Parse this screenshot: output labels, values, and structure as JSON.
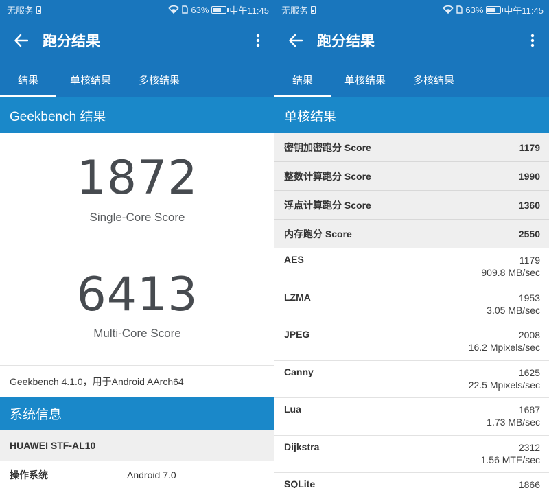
{
  "status_bar": {
    "carrier": "无服务",
    "battery_pct": "63%",
    "time": "中午11:45"
  },
  "app_bar": {
    "title": "跑分结果"
  },
  "tabs": [
    "结果",
    "单核结果",
    "多核结果"
  ],
  "active_tab": 0,
  "left": {
    "section_title": "Geekbench 结果",
    "single_core_score": "1872",
    "single_core_label": "Single-Core Score",
    "multi_core_score": "6413",
    "multi_core_label": "Multi-Core Score",
    "version_text": "Geekbench 4.1.0，用于Android AArch64",
    "system_info_title": "系统信息",
    "device_name": "HUAWEI STF-AL10",
    "info_rows": [
      {
        "key": "操作系统",
        "value": "Android 7.0"
      }
    ]
  },
  "right": {
    "section_title": "单核结果",
    "summary": [
      {
        "label": "密钥加密跑分 Score",
        "value": "1179"
      },
      {
        "label": "整数计算跑分 Score",
        "value": "1990"
      },
      {
        "label": "浮点计算跑分 Score",
        "value": "1360"
      },
      {
        "label": "内存跑分 Score",
        "value": "2550"
      }
    ],
    "benchmarks": [
      {
        "name": "AES",
        "score": "1179",
        "rate": "909.8 MB/sec"
      },
      {
        "name": "LZMA",
        "score": "1953",
        "rate": "3.05 MB/sec"
      },
      {
        "name": "JPEG",
        "score": "2008",
        "rate": "16.2 Mpixels/sec"
      },
      {
        "name": "Canny",
        "score": "1625",
        "rate": "22.5 Mpixels/sec"
      },
      {
        "name": "Lua",
        "score": "1687",
        "rate": "1.73 MB/sec"
      },
      {
        "name": "Dijkstra",
        "score": "2312",
        "rate": "1.56 MTE/sec"
      },
      {
        "name": "SQLite",
        "score": "1866",
        "rate": ""
      }
    ]
  },
  "colors": {
    "app_bar": "#1976bd",
    "section_header": "#1a88c9"
  }
}
